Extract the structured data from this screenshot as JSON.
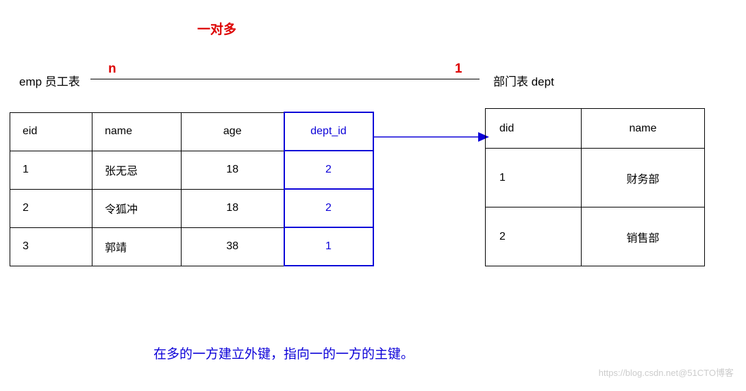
{
  "title": "一对多",
  "relation": {
    "n": "n",
    "one": "1"
  },
  "labels": {
    "emp": "emp 员工表",
    "dept": "部门表 dept"
  },
  "emp": {
    "headers": {
      "eid": "eid",
      "name": "name",
      "age": "age",
      "dept_id": "dept_id"
    },
    "rows": [
      {
        "eid": "1",
        "name": "张无忌",
        "age": "18",
        "dept_id": "2"
      },
      {
        "eid": "2",
        "name": "令狐冲",
        "age": "18",
        "dept_id": "2"
      },
      {
        "eid": "3",
        "name": "郭靖",
        "age": "38",
        "dept_id": "1"
      }
    ]
  },
  "dept": {
    "headers": {
      "did": "did",
      "name": "name"
    },
    "rows": [
      {
        "did": "1",
        "name": "财务部"
      },
      {
        "did": "2",
        "name": "销售部"
      }
    ]
  },
  "note": "在多的一方建立外键，指向一的一方的主键。",
  "watermark": "https://blog.csdn.net@51CTO博客",
  "chart_data": {
    "type": "table",
    "relationship": "one-to-many",
    "many_side": {
      "table": "emp",
      "foreign_key": "dept_id",
      "columns": [
        "eid",
        "name",
        "age",
        "dept_id"
      ],
      "rows": [
        [
          1,
          "张无忌",
          18,
          2
        ],
        [
          2,
          "令狐冲",
          18,
          2
        ],
        [
          3,
          "郭靖",
          38,
          1
        ]
      ]
    },
    "one_side": {
      "table": "dept",
      "primary_key": "did",
      "columns": [
        "did",
        "name"
      ],
      "rows": [
        [
          1,
          "财务部"
        ],
        [
          2,
          "销售部"
        ]
      ]
    },
    "annotation": "在多的一方建立外键，指向一的一方的主键。"
  }
}
